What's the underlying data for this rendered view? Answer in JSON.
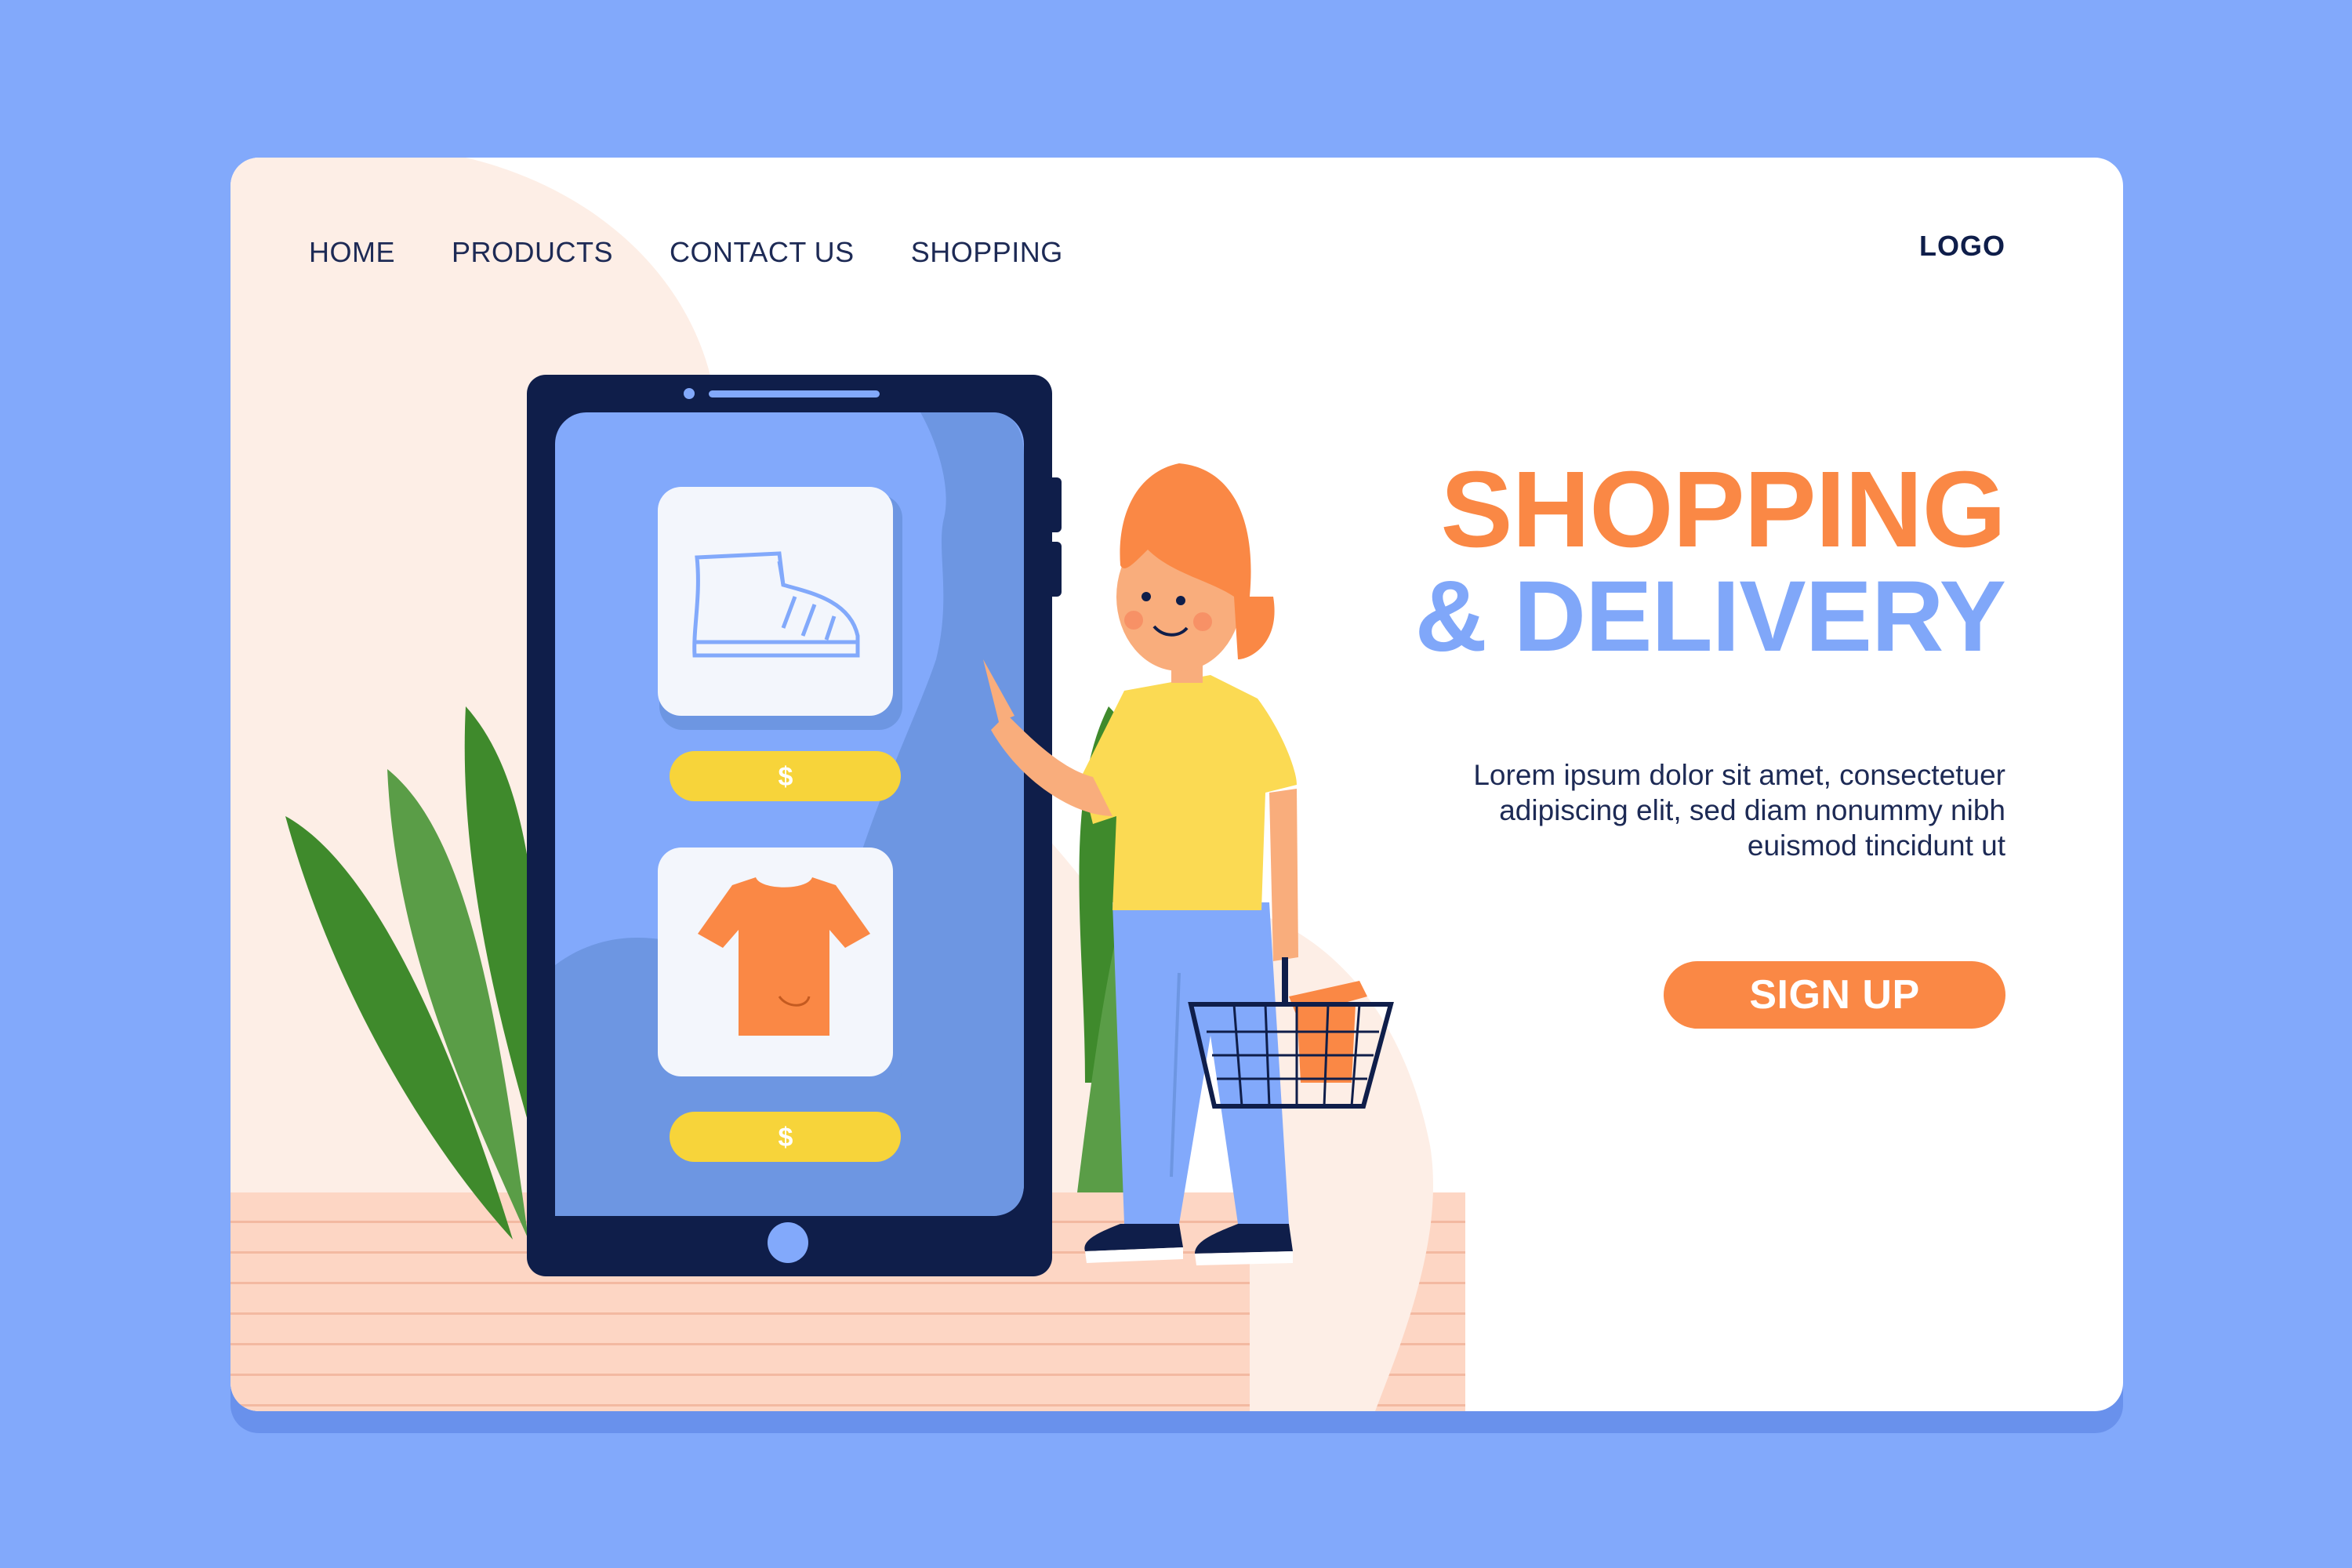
{
  "nav": {
    "items": [
      {
        "label": "HOME"
      },
      {
        "label": "PRODUCTS"
      },
      {
        "label": "CONTACT US"
      },
      {
        "label": "SHOPPING"
      }
    ]
  },
  "logo": "LOGO",
  "hero": {
    "title_line1": "SHOPPING",
    "title_line2": "& DELIVERY",
    "description_line1": "Lorem ipsum dolor sit amet, consectetuer",
    "description_line2": "adipiscing elit, sed diam nonummy nibh",
    "description_line3": "euismod tincidunt ut",
    "cta_label": "SIGN UP"
  },
  "phone": {
    "products": [
      {
        "icon": "sneaker-icon",
        "price_symbol": "$"
      },
      {
        "icon": "tshirt-icon",
        "price_symbol": "$"
      }
    ]
  },
  "colors": {
    "background": "#82a9fb",
    "accent_orange": "#fa8845",
    "accent_blue": "#80a7f9",
    "navy": "#0f1e4a",
    "price_yellow": "#f7d43a"
  }
}
